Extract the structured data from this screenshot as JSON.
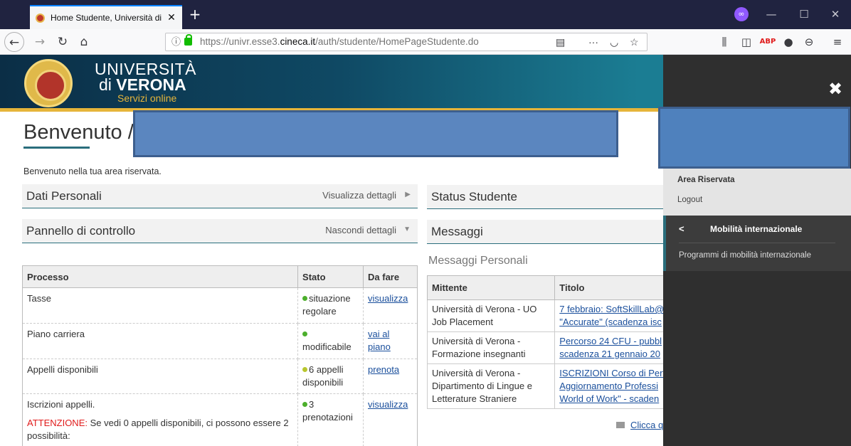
{
  "browser": {
    "tab_title": "Home Studente, Università di V",
    "tab_close": "✕",
    "new_tab": "+",
    "url_prefix": "https://univr.esse3.",
    "url_domain": "cineca.it",
    "url_suffix": "/auth/studente/HomePageStudente.do",
    "private_badge": "∞"
  },
  "header": {
    "line1": "UNIVERSITÀ",
    "line2_prefix": "di ",
    "line2_bold": "VERONA",
    "line3": "Servizi online"
  },
  "page": {
    "welcome": "Benvenuto /",
    "subtitle": "Benvenuto nella tua area riservata."
  },
  "sections": {
    "dati": {
      "title": "Dati Personali",
      "link": "Visualizza dettagli"
    },
    "pannello": {
      "title": "Pannello di controllo",
      "link": "Nascondi dettagli"
    },
    "status": {
      "title": "Status Studente"
    },
    "messaggi": {
      "title": "Messaggi",
      "subtitle": "Messaggi Personali"
    }
  },
  "proc_table": {
    "headers": [
      "Processo",
      "Stato",
      "Da fare"
    ],
    "rows": [
      {
        "processo": "Tasse",
        "stato": "situazione regolare",
        "dafare": "visualizza"
      },
      {
        "processo": "Piano carriera",
        "stato": "modificabile",
        "dafare": "vai al piano"
      },
      {
        "processo": "Appelli disponibili",
        "stato": "6 appelli disponibili",
        "dafare": "prenota"
      },
      {
        "processo": "Iscrizioni appelli.",
        "warn_label": "ATTENZIONE:",
        "warn_text": " Se vedi 0 appelli disponibili, ci possono essere 2 possibilità:",
        "stato": "3 prenotazioni",
        "dafare": "visualizza"
      }
    ]
  },
  "msg_table": {
    "headers": [
      "Mittente",
      "Titolo"
    ],
    "rows": [
      {
        "mittente1": "Università di Verona - UO",
        "mittente2": "Job Placement",
        "titolo1": "7 febbraio: SoftSkillLab@",
        "titolo2": "\"Accurate\" (scadenza isc"
      },
      {
        "mittente1": "Università di Verona -",
        "mittente2": "Formazione insegnanti",
        "titolo1": "Percorso 24 CFU - pubbl",
        "titolo2": "scadenza 21 gennaio 20"
      },
      {
        "mittente1": "Università di Verona -",
        "mittente2": "Dipartimento di Lingue e",
        "mittente3": "Letterature Straniere",
        "titolo1": "ISCRIZIONI Corso di Perf",
        "titolo2": "Aggiornamento Professi",
        "titolo3": "World of Work\" - scaden"
      }
    ],
    "more_link": "Clicca q"
  },
  "sidepanel": {
    "close": "✖",
    "area_title": "Area Riservata",
    "logout": "Logout",
    "mob_title": "Mobilità internazionale",
    "mob_item": "Programmi di mobilità internazionale"
  }
}
